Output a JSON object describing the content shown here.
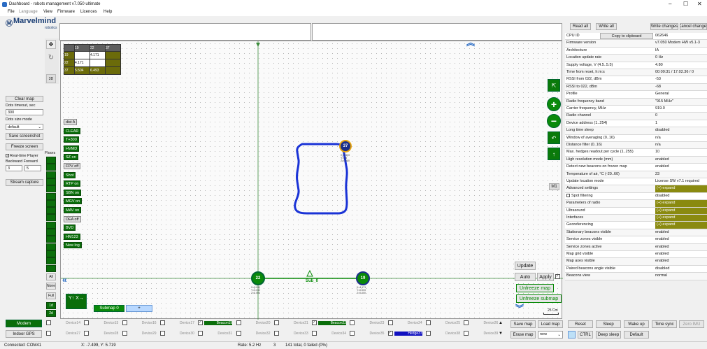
{
  "window": {
    "title": "Dashboard - robots management  v7.050  ultimate"
  },
  "menu": [
    "File",
    "Language",
    "View",
    "Firmware",
    "Licences",
    "Help"
  ],
  "brand": {
    "name": "Marvelmind",
    "sub": "robotics"
  },
  "left": {
    "clear_map": "Clear map",
    "dots_timeout_label": "Dots timeout, sec",
    "dots_timeout_value": "300",
    "dots_size_label": "Dots size mode",
    "dots_size_value": "default",
    "save_screenshot": "Save screenshot",
    "freeze_screen": "Freeze screen",
    "realtime_player": "Real-time Player",
    "backward_forward": "Backward Forward",
    "step_a": "3",
    "step_b": "5",
    "stream_capture": "Stream capture",
    "floors_label": "Floors",
    "floors": [
      "",
      "",
      "",
      "",
      "",
      "",
      "",
      "",
      "",
      "",
      "",
      "",
      "",
      "",
      "",
      ""
    ],
    "btn_all": "All",
    "btn_none": "None",
    "btn_full": "Full",
    "btn_1d": "1d",
    "btn_2d": "2d",
    "view_3d": "3D",
    "modem_btn": "Modem",
    "indoor_gps_btn": "Indoor GPS"
  },
  "distance_table": {
    "header": [
      "",
      "19",
      "22",
      "37"
    ],
    "rows": [
      [
        "19",
        "",
        "4.171",
        ""
      ],
      [
        "22",
        "4.171",
        "",
        ""
      ],
      [
        "37",
        "5.504",
        "6.493",
        ""
      ]
    ]
  },
  "map_buttons": [
    "dist A",
    "CLEAR",
    "T+300",
    "HVMD",
    "SZ on",
    "FPV off",
    "Shot",
    "RTP on",
    "SBN on",
    "MGV on",
    "MAV on",
    "DEA off",
    "BVD",
    "HM123",
    "New log"
  ],
  "beacons": [
    {
      "id": "37",
      "info1": "X=2.500",
      "info2": "Y=0.5",
      "info3": "Z=0.000"
    },
    {
      "id": "22",
      "info1": "X=0.000",
      "info2": "Y=0.000",
      "info3": "Z=0.000"
    },
    {
      "id": "19",
      "info1": "X=4.171",
      "info2": "Y=0.000",
      "info3": "Z=0.000"
    }
  ],
  "submap_label": "Sub_0",
  "submap_bar": {
    "label": "Submap  0",
    "add": "+"
  },
  "map_right": {
    "update": "Update",
    "auto": "Auto",
    "apply": "Apply",
    "unfreeze_map": "Unfreeze map",
    "unfreeze_submap": "Unfreeze submap",
    "scale": "25 Cm",
    "m1": "M1"
  },
  "props_top": {
    "read_all": "Read all",
    "write_all": "Write all",
    "write_changes": "Write changes",
    "cancel_changes": "Cancel changes"
  },
  "props": [
    {
      "k": "CPU ID",
      "v": "062646",
      "copy": "Copy to clipboard"
    },
    {
      "k": "Firmware version",
      "v": "v7.050 Modem HW v5.1-3"
    },
    {
      "k": "Architecture",
      "v": "IA"
    },
    {
      "k": "Location update rate",
      "v": "0 Hz"
    },
    {
      "k": "Supply voltage, V (4.5..5.5)",
      "v": "4.80"
    },
    {
      "k": "Time from reset, h:m:s",
      "v": "00:09:31 / 17.02.36 / 0"
    },
    {
      "k": "RSSI from 022, dBm",
      "v": "-53"
    },
    {
      "k": "RSSI to 022, dBm",
      "v": "-68"
    },
    {
      "k": "Profile",
      "v": "General"
    },
    {
      "k": "Radio frequency band",
      "v": "\"915 MHz\""
    },
    {
      "k": "Carrier frequency, MHz",
      "v": "919.0"
    },
    {
      "k": "Radio channel",
      "v": "0"
    },
    {
      "k": "Device address (1..254)",
      "v": "1"
    },
    {
      "k": "Long time sleep",
      "v": "disabled"
    },
    {
      "k": "Window of averaging (0..16)",
      "v": "n/a"
    },
    {
      "k": "Distance filter (0..16)",
      "v": "n/a"
    },
    {
      "k": "Max. hedges readout per cycle (1..255)",
      "v": "10"
    },
    {
      "k": "High resolution mode (mm)",
      "v": "enabled"
    },
    {
      "k": "Detect new beacons on frozen map",
      "v": "enabled"
    },
    {
      "k": "Temperature of air, °C (-20..60)",
      "v": "23"
    },
    {
      "k": "Update location mode",
      "v": "License SW v7.1 required"
    },
    {
      "k": "Advanced settings",
      "v": "(+) expand",
      "exp": true
    },
    {
      "k": "Spot filtering",
      "v": "disabled",
      "cb": true
    },
    {
      "k": "Parameters of radio",
      "v": "(+) expand",
      "exp": true
    },
    {
      "k": "Ultrasound",
      "v": "(+) expand",
      "exp": true
    },
    {
      "k": "Interfaces",
      "v": "(+) expand",
      "exp": true
    },
    {
      "k": "Georeferencing",
      "v": "(+) expand",
      "exp": true
    },
    {
      "k": "Stationary beacons visible",
      "v": "enabled"
    },
    {
      "k": "Service zones visible",
      "v": "enabled"
    },
    {
      "k": "Service zones active",
      "v": "enabled"
    },
    {
      "k": "Map grid visible",
      "v": "enabled"
    },
    {
      "k": "Map axes visible",
      "v": "enabled"
    },
    {
      "k": "Paired beacons angle visible",
      "v": "disabled"
    },
    {
      "k": "Beacons view",
      "v": "normal"
    }
  ],
  "devices_row1": [
    "Device14",
    "Device15",
    "Device16",
    "Device17",
    "Beacon19",
    "Device20",
    "Device21",
    "Beacon22",
    "Device23",
    "Device24",
    "Device25",
    "Device26"
  ],
  "devices_row2": [
    "Device27",
    "Device28",
    "Device29",
    "Device30",
    "Device31",
    "Device32",
    "Device33",
    "Device34",
    "Device35",
    "Hedge37",
    "Device38",
    "Device39"
  ],
  "bottom_buttons": {
    "save_map": "Save map",
    "load_map": "Load map",
    "erase_map": "Erase map",
    "new": "new",
    "reset": "Reset",
    "sleep": "Sleep",
    "wake_up": "Wake up",
    "time_sync": "Time sync",
    "zero_imu": "Zero IMU",
    "ctrl": "CTRL",
    "deep_sleep": "Deep sleep",
    "default": "Default"
  },
  "status": {
    "connected": "Connected: COM41",
    "coords": "X: -7.499, Y: 5.719",
    "rate": "Rate: 5.2 Hz",
    "count": "3",
    "total": "141 total, 0 failed (0%)"
  }
}
